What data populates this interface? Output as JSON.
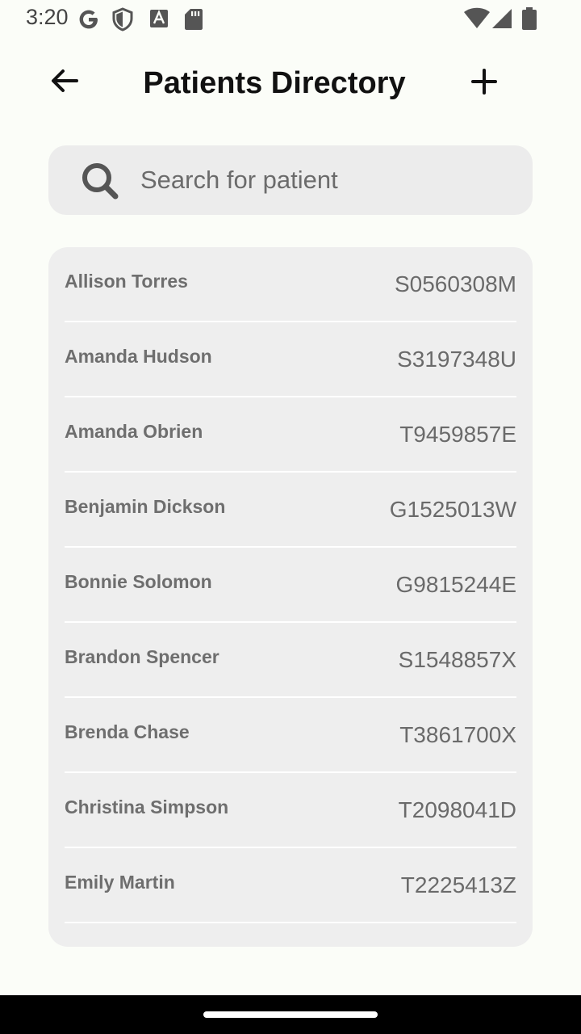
{
  "status_bar": {
    "time": "3:20",
    "icons": [
      "google-icon",
      "shield-icon",
      "font-icon",
      "sd-card-icon",
      "wifi-icon",
      "signal-icon",
      "battery-icon"
    ]
  },
  "header": {
    "title": "Patients Directory",
    "back_icon": "arrow-left-icon",
    "add_icon": "plus-icon"
  },
  "search": {
    "placeholder": "Search for patient",
    "value": "",
    "icon": "search-icon"
  },
  "patients": [
    {
      "name": "Allison Torres",
      "id": "S0560308M"
    },
    {
      "name": "Amanda Hudson",
      "id": "S3197348U"
    },
    {
      "name": "Amanda Obrien",
      "id": "T9459857E"
    },
    {
      "name": "Benjamin Dickson",
      "id": "G1525013W"
    },
    {
      "name": "Bonnie Solomon",
      "id": "G9815244E"
    },
    {
      "name": "Brandon Spencer",
      "id": "S1548857X"
    },
    {
      "name": "Brenda Chase",
      "id": "T3861700X"
    },
    {
      "name": "Christina Simpson",
      "id": "T2098041D"
    },
    {
      "name": "Emily Martin",
      "id": "T2225413Z"
    }
  ],
  "colors": {
    "background": "#fbfdf8",
    "card": "#eeeeee",
    "search_bg": "#ececec",
    "text_muted": "#6e6e6e",
    "nav_bar": "#000000"
  }
}
